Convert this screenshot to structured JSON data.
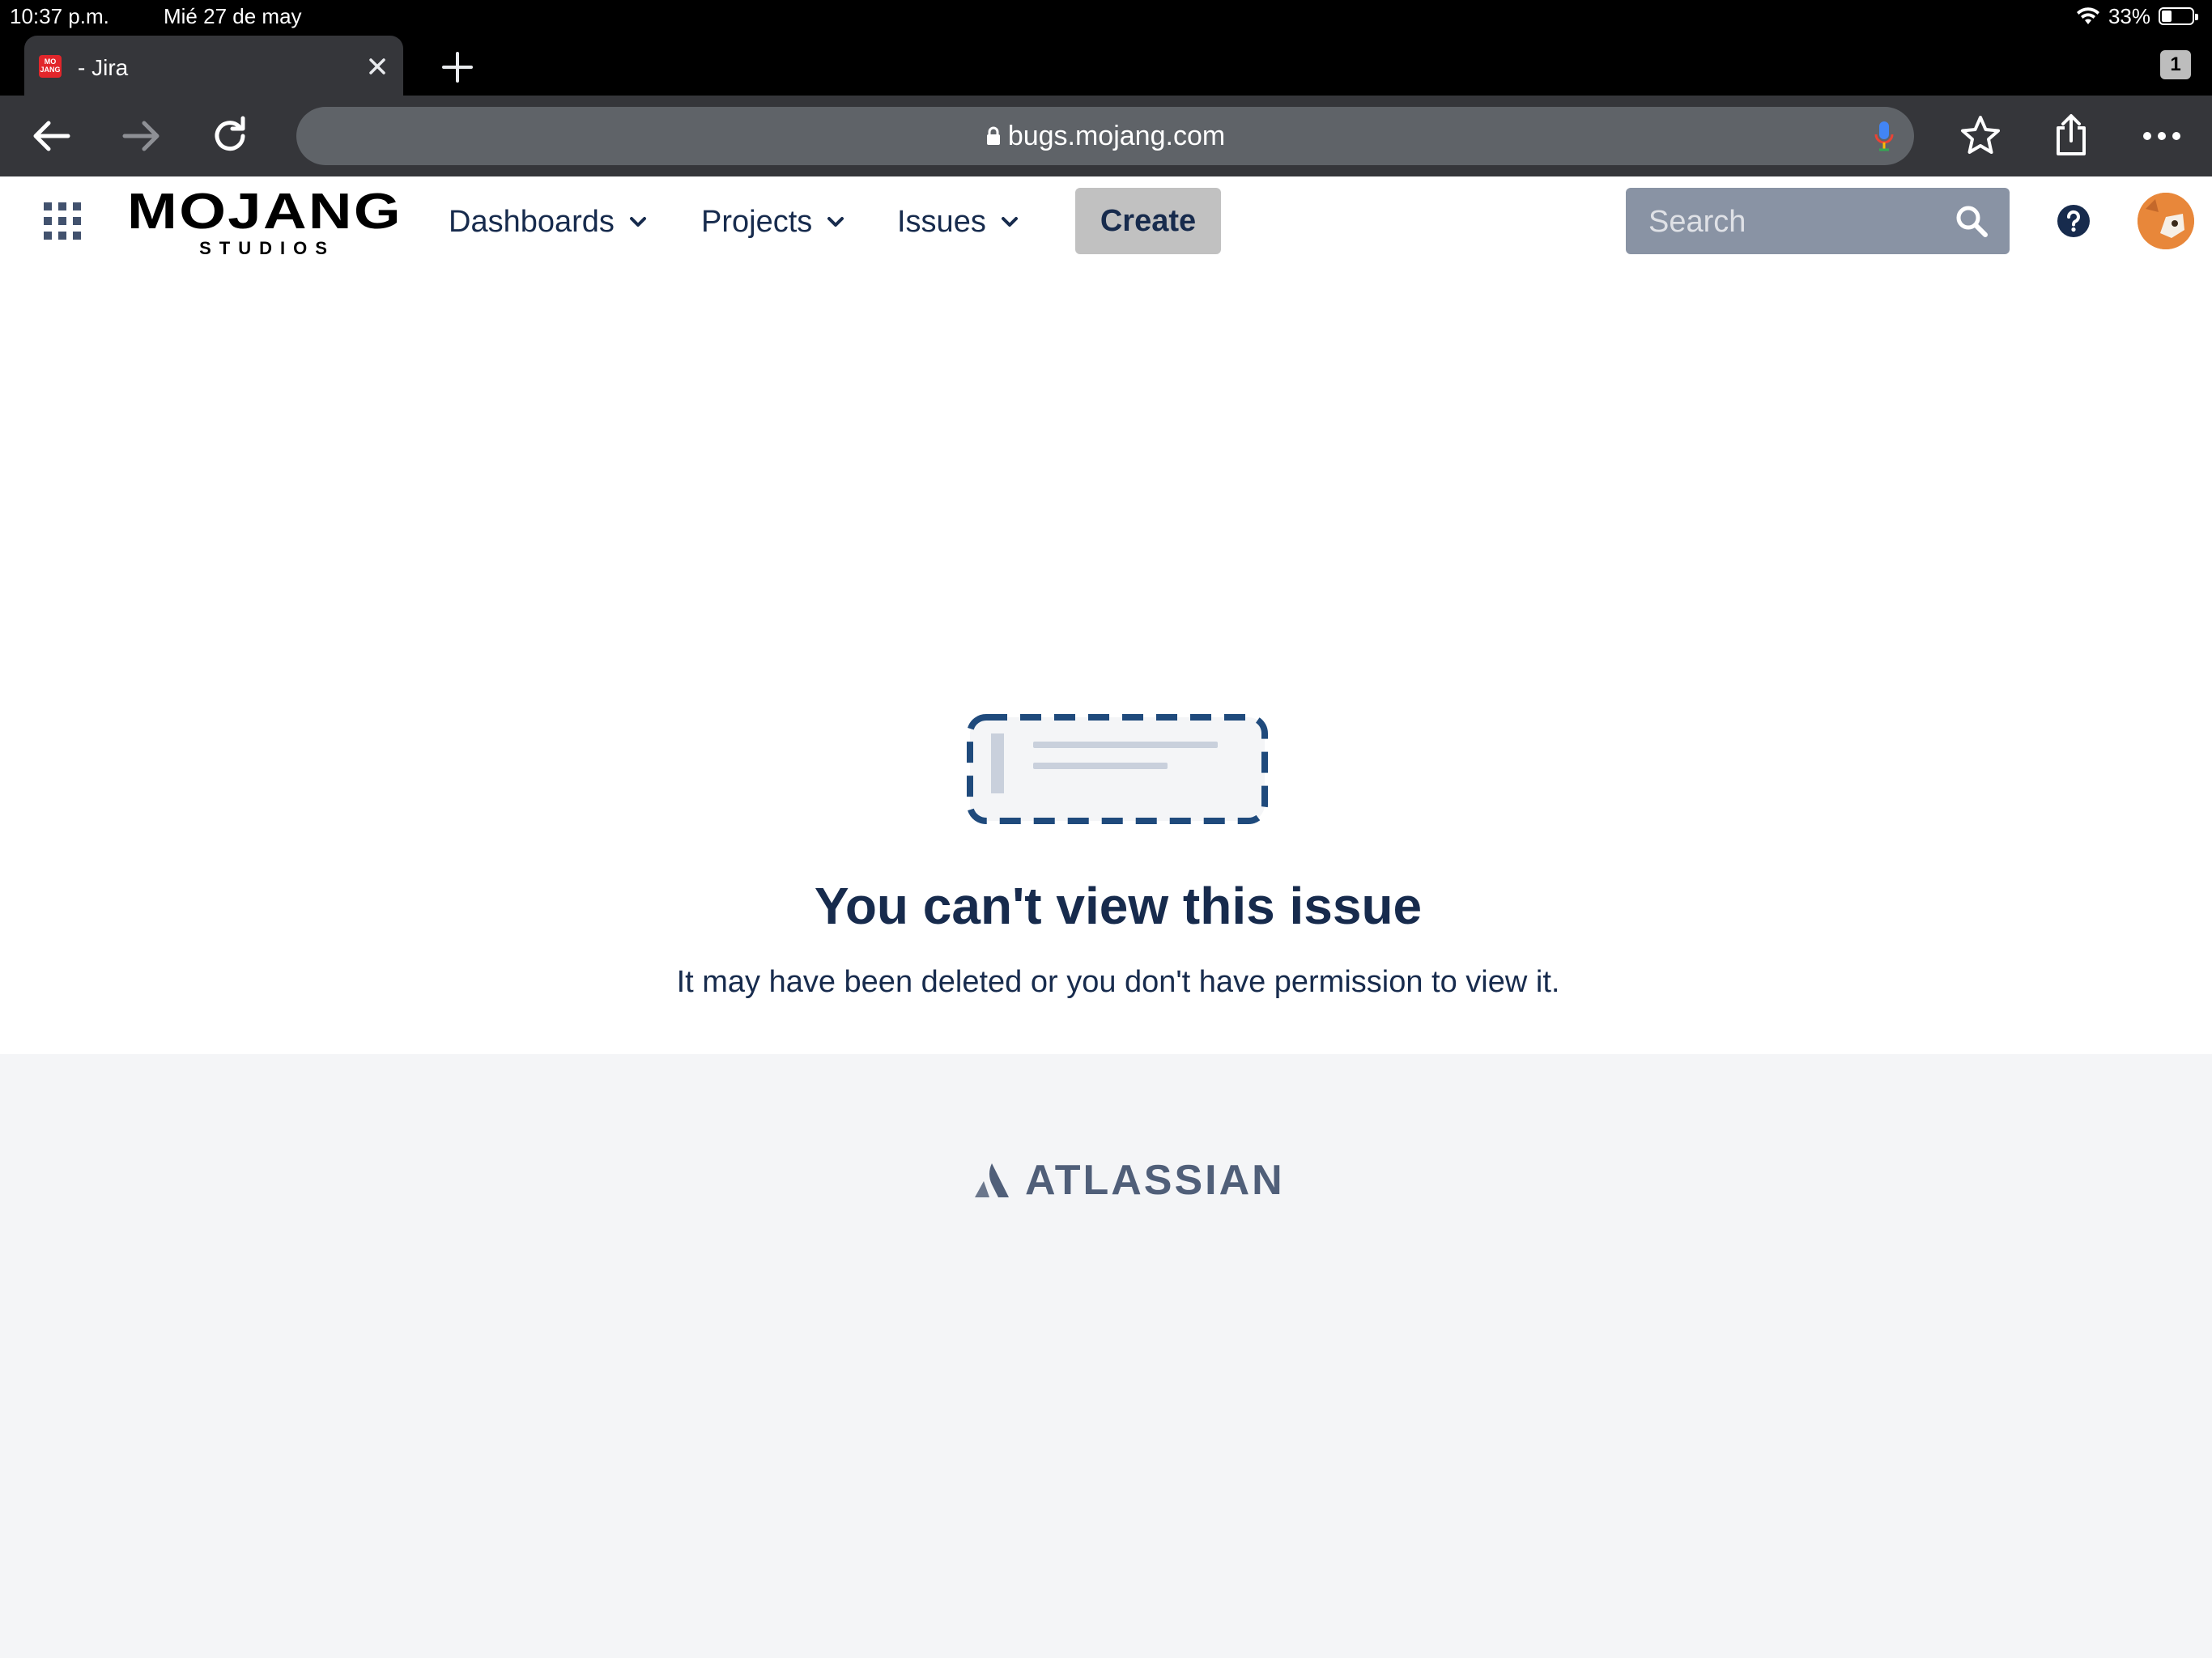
{
  "status_bar": {
    "time": "10:37 p.m.",
    "date": "Mié 27 de may",
    "battery": "33%",
    "battery_level": 0.33
  },
  "browser": {
    "tab_title": "- Jira",
    "tab_count": "1",
    "url": "bugs.mojang.com"
  },
  "header": {
    "logo_text": "MOJANG",
    "logo_subtext": "STUDIOS",
    "nav": [
      {
        "label": "Dashboards"
      },
      {
        "label": "Projects"
      },
      {
        "label": "Issues"
      }
    ],
    "create_label": "Create",
    "search_placeholder": "Search"
  },
  "message": {
    "title": "You can't view this issue",
    "subtitle": "It may have been deleted or you don't have permission to view it."
  },
  "footer": {
    "brand": "ATLASSIAN"
  },
  "colors": {
    "text_primary": "#172b4d",
    "footer_bg": "#f4f5f7",
    "search_bg": "#8993a4",
    "dashed_border": "#1f4a7c",
    "create_bg": "#c1c1c1"
  }
}
